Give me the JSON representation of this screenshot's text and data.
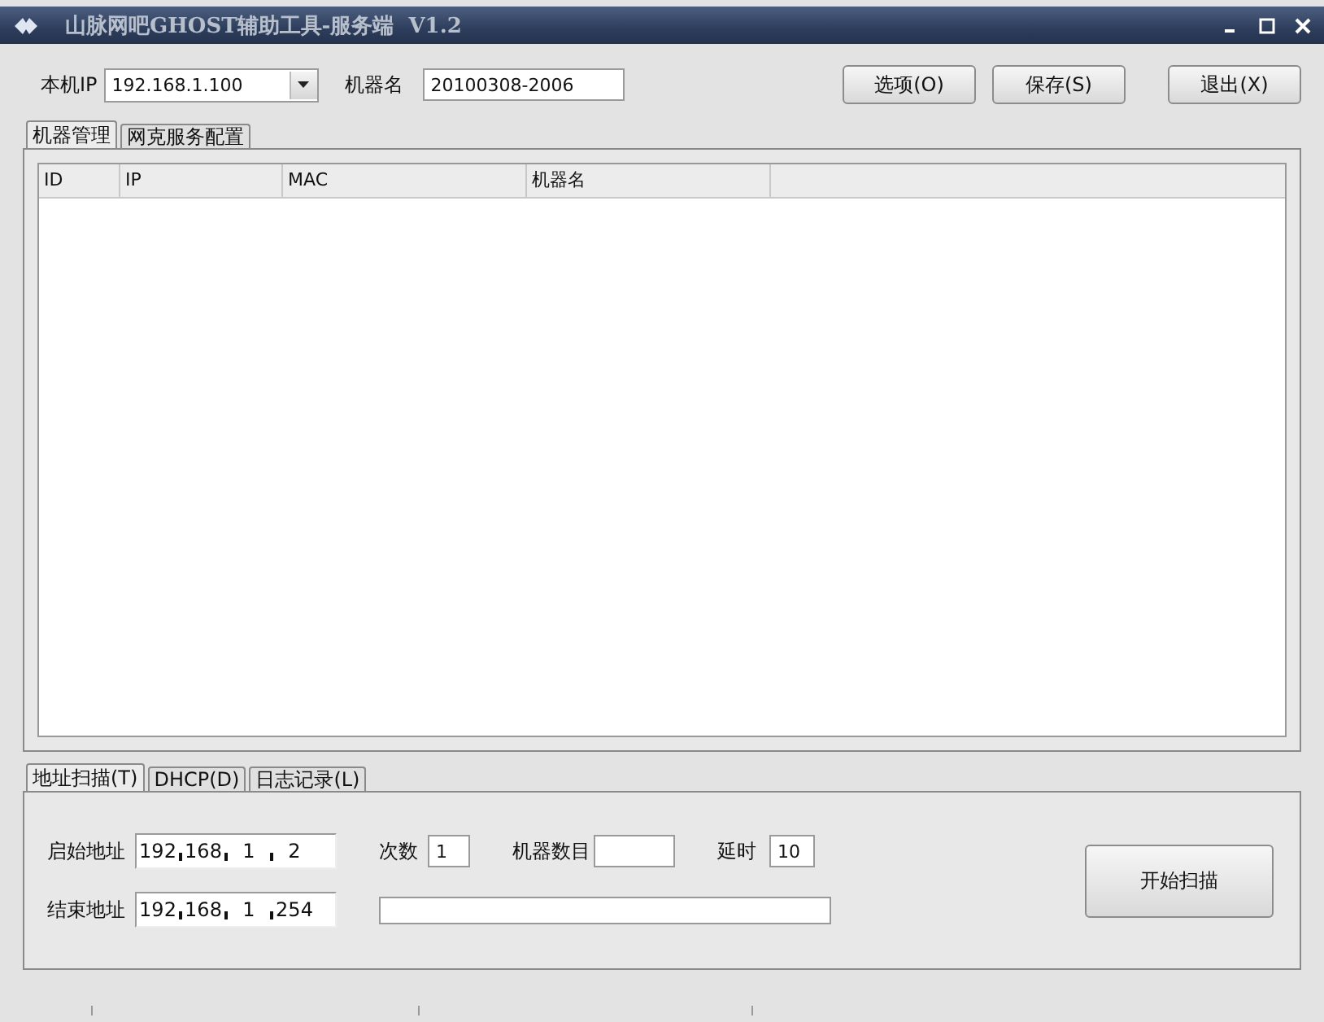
{
  "window": {
    "title": "山脉网吧GHOST辅助工具-服务端  V1.2"
  },
  "toolbar": {
    "ip_label": "本机IP",
    "ip_value": "192.168.1.100",
    "name_label": "机器名",
    "name_value": "20100308-2006",
    "buttons": [
      "选项(O)",
      "保存(S)",
      "退出(X)"
    ]
  },
  "top_tabs": [
    {
      "label": "机器管理",
      "selected": true
    },
    {
      "label": "网克服务配置",
      "selected": false
    }
  ],
  "table": {
    "columns": [
      "ID",
      "IP",
      "MAC",
      "机器名"
    ]
  },
  "bottom_tabs": [
    {
      "label": "地址扫描(T)",
      "selected": true
    },
    {
      "label": "DHCP(D)",
      "selected": false
    },
    {
      "label": "日志记录(L)",
      "selected": false
    }
  ],
  "scan": {
    "start_label": "启始地址",
    "start_ip": [
      "192",
      "168",
      "1",
      "2"
    ],
    "end_label": "结束地址",
    "end_ip": [
      "192",
      "168",
      "1",
      "254"
    ],
    "count_label": "次数",
    "count_value": "1",
    "machines_label": "机器数目",
    "delay_label": "延时",
    "delay_value": "10",
    "start_button": "开始扫描",
    "progress": {
      "level": 0
    }
  }
}
